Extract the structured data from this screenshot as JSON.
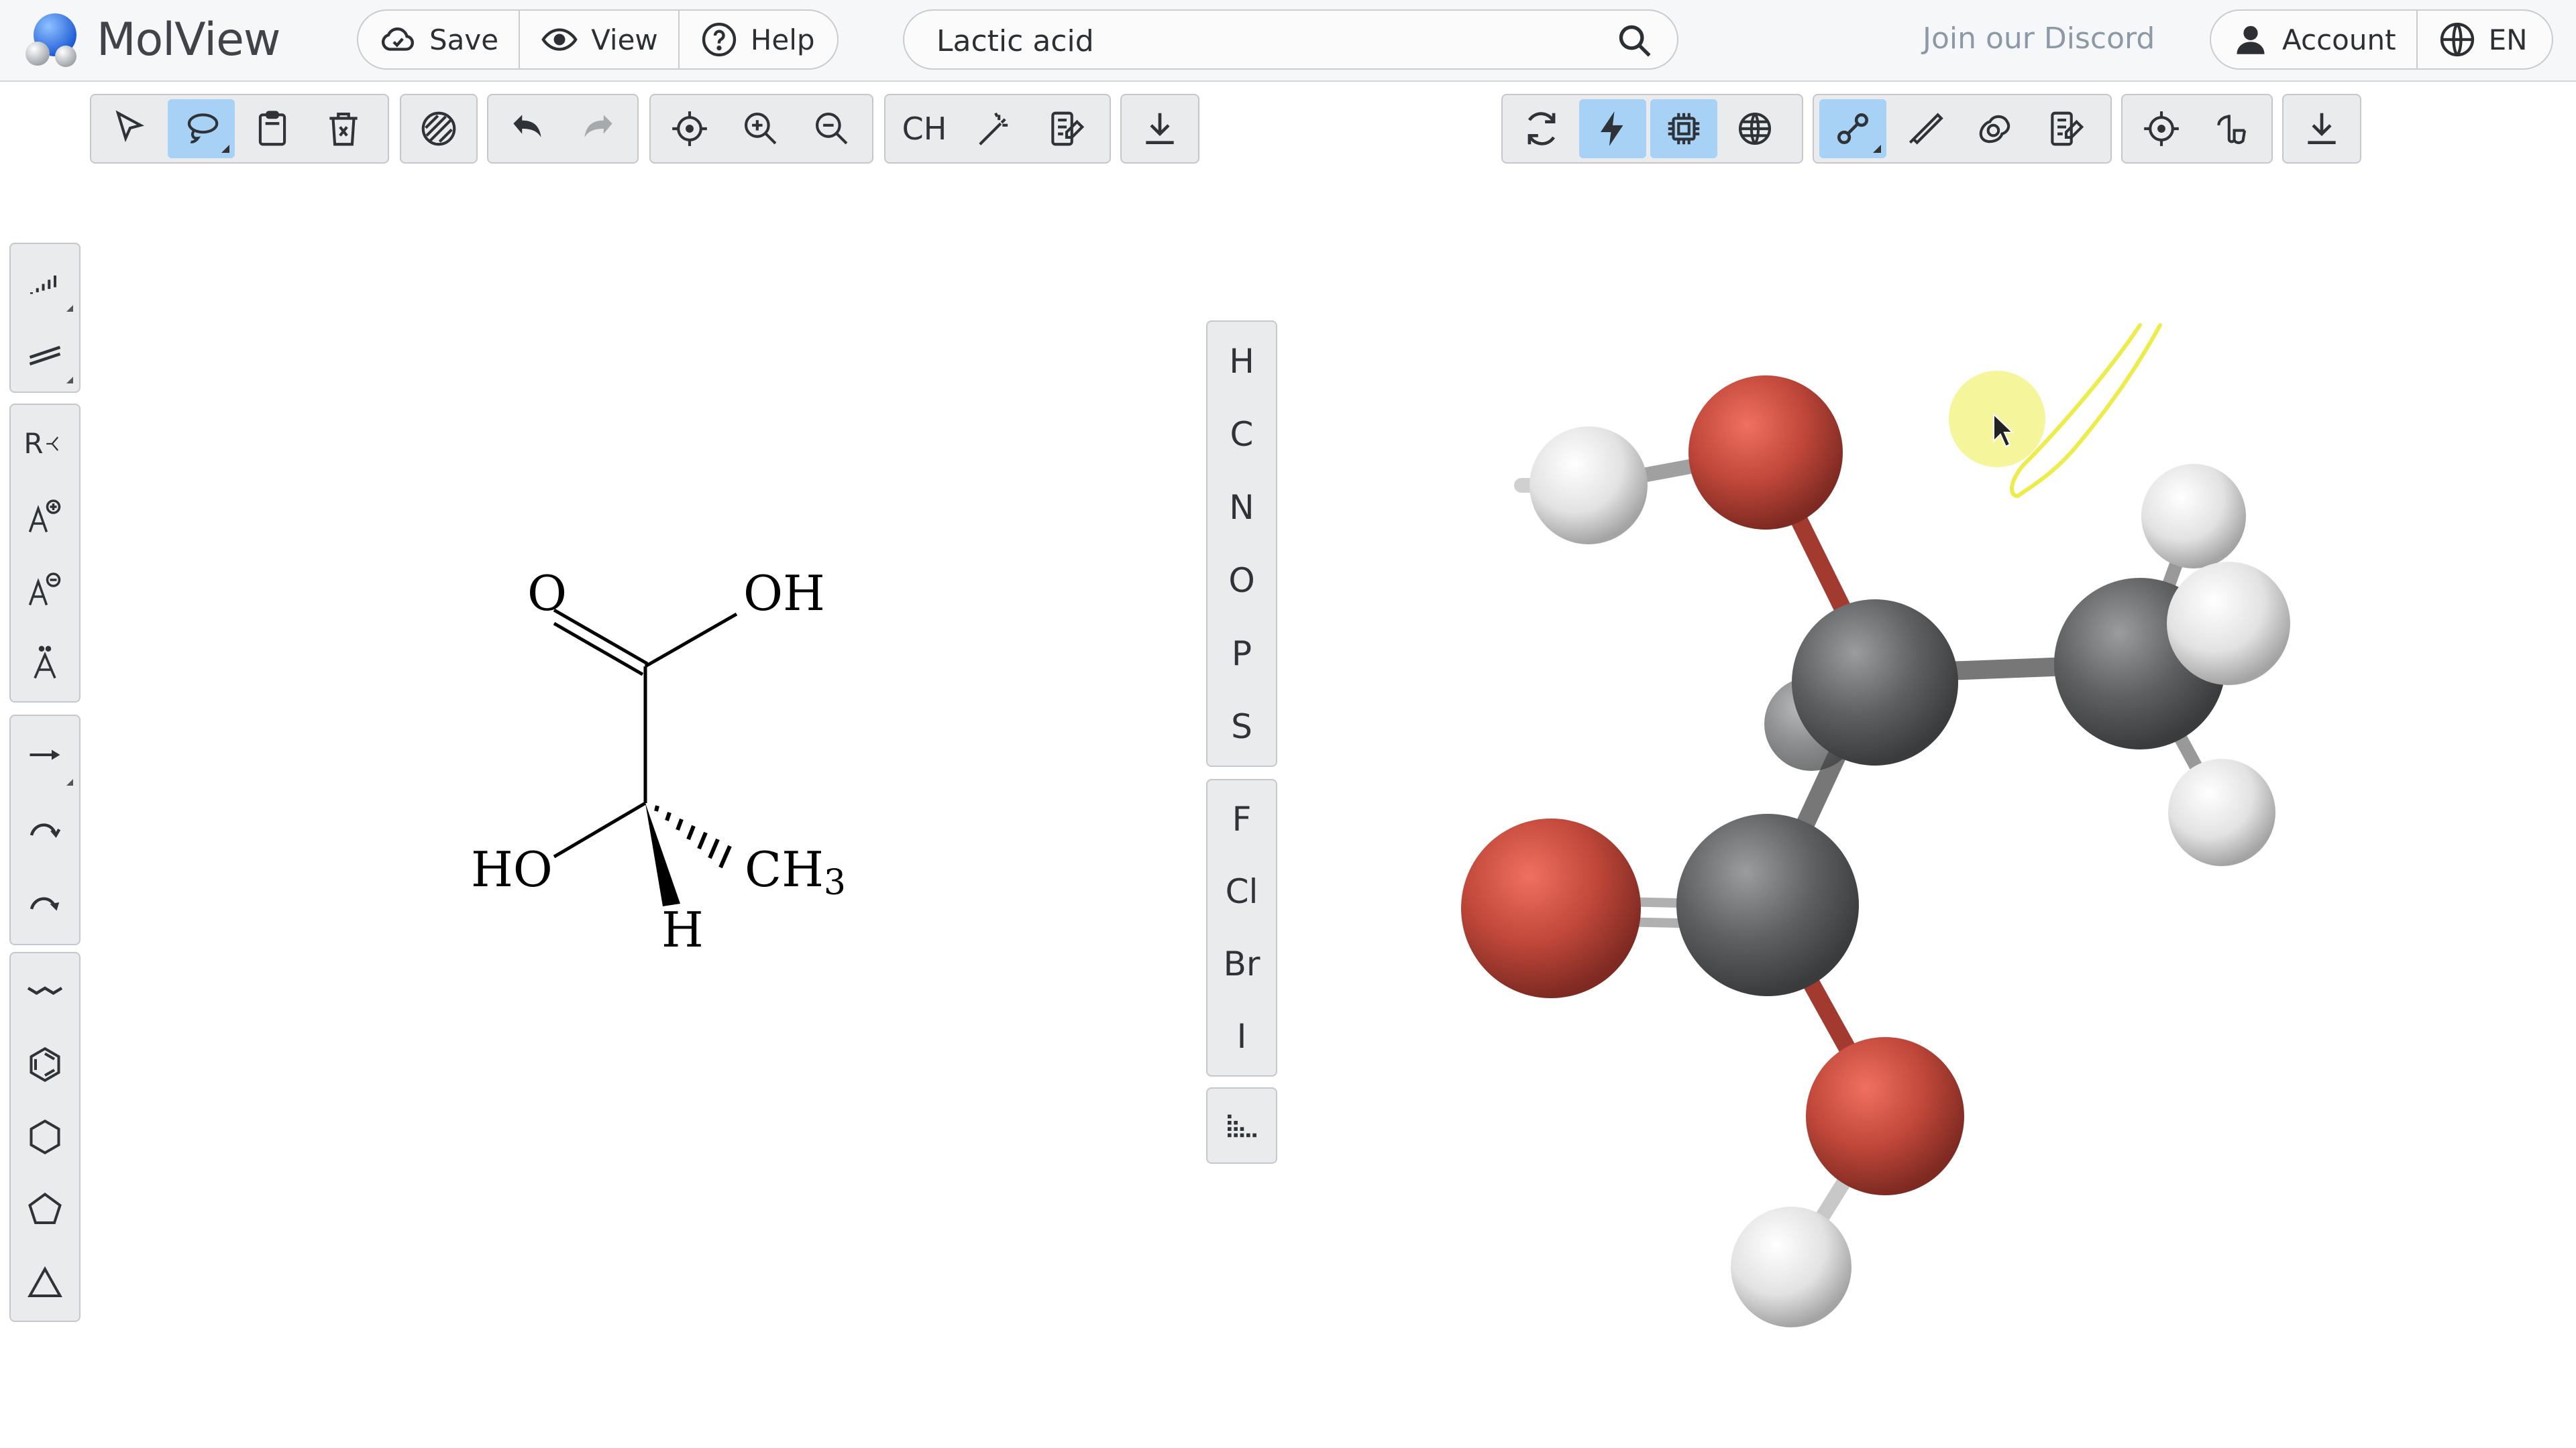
{
  "app": {
    "name": "MolView"
  },
  "header": {
    "save_label": "Save",
    "view_label": "View",
    "help_label": "Help",
    "search_value": "Lactic acid",
    "discord_label": "Join our Discord",
    "account_label": "Account",
    "language_label": "EN"
  },
  "elements": [
    "H",
    "C",
    "N",
    "O",
    "P",
    "S",
    "F",
    "Cl",
    "Br",
    "I"
  ],
  "sketcher_toolbar": {
    "ch_label": "CH"
  },
  "left_tools": {
    "rgroup_label": "R"
  },
  "structure_labels": {
    "o": "O",
    "oh": "OH",
    "ho": "HO",
    "ch3_main": "CH",
    "ch3_sub": "3",
    "h": "H"
  },
  "colors": {
    "accent_active": "#a8d2f5",
    "oxygen": "#c0473a",
    "carbon": "#5a5c5e",
    "hydrogen": "#e8e8e8",
    "annotation": "#ecec4a"
  }
}
